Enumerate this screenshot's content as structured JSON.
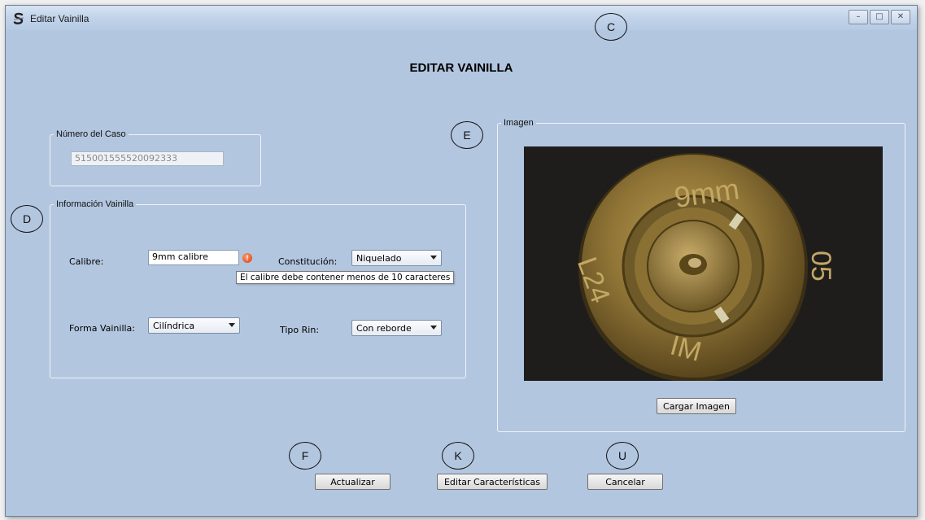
{
  "window": {
    "title": "Editar Vainilla",
    "controls": {
      "minimize": "–",
      "maximize": "□",
      "close": "✕"
    }
  },
  "page_title": "EDITAR VAINILLA",
  "markers": {
    "c": "C",
    "d": "D",
    "e": "E",
    "f": "F",
    "k": "K",
    "u": "U"
  },
  "case_group": {
    "legend": "Número del Caso",
    "case_number": "515001555520092333"
  },
  "info_group": {
    "legend": "Información Vainilla",
    "calibre_label": "Calibre:",
    "calibre_value": "9mm  calibre",
    "calibre_error": "El calibre debe contener menos de 10 caracteres",
    "constitucion_label": "Constitución:",
    "constitucion_value": "Niquelado",
    "forma_label": "Forma Vainilla:",
    "forma_value": "Cilíndrica",
    "rin_label": "Tipo Rin:",
    "rin_value": "Con reborde"
  },
  "image_group": {
    "legend": "Imagen",
    "load_button": "Cargar Imagen",
    "headstamp": {
      "top": "9mm",
      "left": "L24",
      "right": "05",
      "bottom": "IM"
    }
  },
  "actions": {
    "update": "Actualizar",
    "edit_features": "Editar Características",
    "cancel": "Cancelar"
  },
  "colors": {
    "window_bg": "#b3c6df",
    "error_icon": "#d43a0e"
  }
}
